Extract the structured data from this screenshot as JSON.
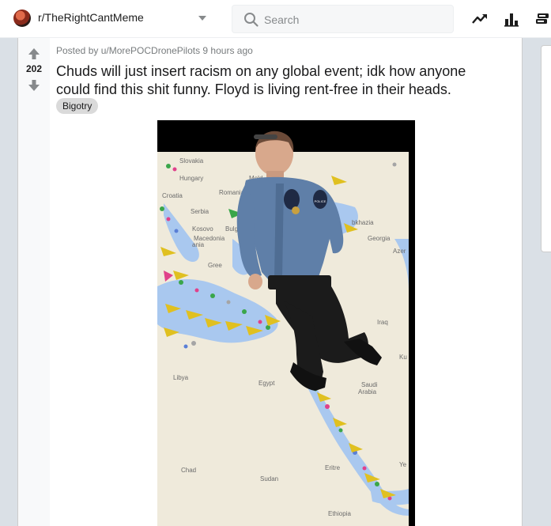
{
  "header": {
    "subreddit": "r/TheRightCantMeme",
    "search_placeholder": "Search",
    "icons": [
      "trending-icon",
      "stats-icon",
      "coins-icon"
    ]
  },
  "post": {
    "votes": "202",
    "meta": "Posted by u/MorePOCDronePilots 9 hours ago",
    "title": "Chuds will just insert racism on any global event; idk how anyone could find this shit funny. Floyd is living rent-free in their heads.",
    "flair": "Bigotry",
    "map_labels": {
      "slovakia": "Slovakia",
      "hungary": "Hungary",
      "moldova": "Mold",
      "croatia": "Croatia",
      "romania": "Romania",
      "serbia": "Serbia",
      "kosovo": "Kosovo",
      "bulgaria": "Bulgaria",
      "macedonia": "Macedonia",
      "albania": "ania",
      "greece": "Gree",
      "abkhazia": "bkhazia",
      "georgia": "Georgia",
      "azer": "Azer",
      "iraq": "Iraq",
      "kuwait": "Ku",
      "libya": "Libya",
      "egypt": "Egypt",
      "saudi": "Saudi",
      "arabia": "Arabia",
      "eritrea": "Eritre",
      "yemen": "Ye",
      "chad": "Chad",
      "sudan": "Sudan",
      "ethiopia": "Ethiopia",
      "badge": "POLICE"
    }
  },
  "colors": {
    "accent": "#0079d3",
    "sea": "#a9c8ef",
    "land": "#efeadb",
    "uniform": "#5f7fa8"
  }
}
